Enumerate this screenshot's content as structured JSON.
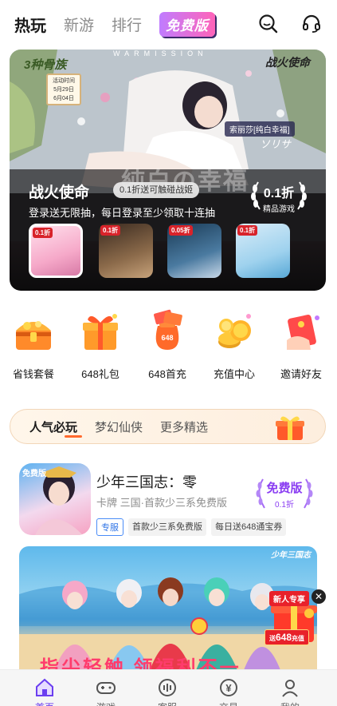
{
  "topnav": {
    "tabs": [
      "热玩",
      "新游",
      "排行"
    ],
    "active_tab": "热玩",
    "free_tab": "免费版",
    "icons": [
      "search-icon",
      "headset-icon"
    ]
  },
  "banner": {
    "sub_logo": "3种骨族",
    "event_card": [
      "活动时间",
      "5月29日",
      "6月04日"
    ],
    "brand_logo": "战火使命",
    "ribbon": "WARMISSION",
    "char_tag": "索丽莎[纯白幸福]",
    "char_jp": "ソリサ",
    "bg_jp": "純白の幸福",
    "title": "战火使命",
    "badge": "0.1折送可触碰战姬",
    "desc": "登录送无限抽，每日登录至少领取十连抽",
    "discount_value": "0.1折",
    "discount_label": "精品游戏",
    "thumbs": [
      {
        "tag": "0.1折"
      },
      {
        "tag": "0.1折"
      },
      {
        "tag": "0.05折"
      },
      {
        "tag": "0.1折"
      }
    ]
  },
  "categories": [
    {
      "label": "省钱套餐",
      "icon": "treasure-chest-icon"
    },
    {
      "label": "648礼包",
      "icon": "gift-box-icon"
    },
    {
      "label": "648首充",
      "icon": "money-bag-icon"
    },
    {
      "label": "充值中心",
      "icon": "coins-icon"
    },
    {
      "label": "邀请好友",
      "icon": "red-envelope-icon"
    }
  ],
  "pills": [
    "人气必玩",
    "梦幻仙侠",
    "更多精选"
  ],
  "active_pill": "人气必玩",
  "game": {
    "name": "少年三国志：零",
    "meta": "卡牌  三国·首款少三系免费版",
    "tags": [
      "专服",
      "首款少三系免费版",
      "每日送648通宝券"
    ],
    "free_label": "免费版",
    "free_discount": "0.1折",
    "icon_badge": "免费版"
  },
  "promo": {
    "logo": "少年三国志",
    "text": "指尖轻触 领福利不一"
  },
  "new_gift": {
    "title": "新人专享",
    "amount": "648",
    "unit": "充值",
    "prefix": "送"
  },
  "tabbar": [
    {
      "label": "首页",
      "icon": "home-icon"
    },
    {
      "label": "游戏",
      "icon": "gamepad-icon"
    },
    {
      "label": "客服",
      "icon": "support-icon"
    },
    {
      "label": "交易",
      "icon": "trade-icon"
    },
    {
      "label": "我的",
      "icon": "profile-icon"
    }
  ],
  "colors": {
    "accent": "#6b3ff0",
    "free_purple": "#8a3df2",
    "orange": "#ff6a2e",
    "red": "#e8212a"
  }
}
